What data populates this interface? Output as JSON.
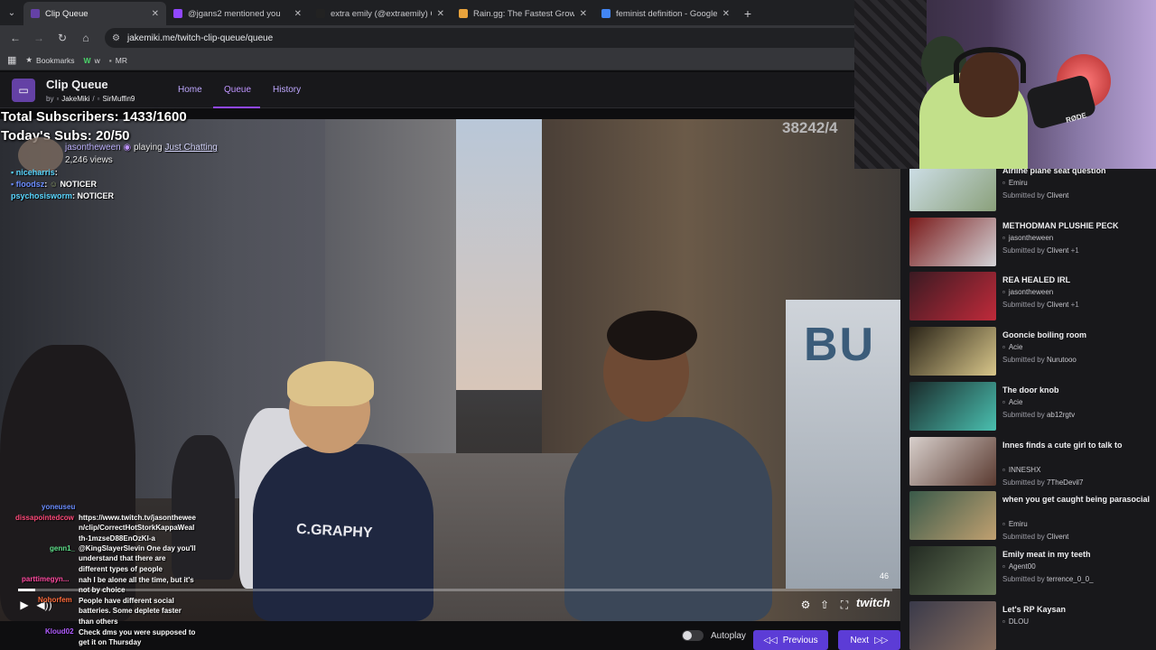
{
  "browser": {
    "tabs": [
      {
        "title": "Clip Queue",
        "active": true,
        "favicon_color": "#6441a5"
      },
      {
        "title": "@jgans2 mentioned you",
        "active": false,
        "favicon_color": "#9147ff"
      },
      {
        "title": "extra emily (@extraemily) Offici",
        "active": false,
        "favicon_color": "#222222"
      },
      {
        "title": "Rain.gg: The Fastest Growing C",
        "active": false,
        "favicon_color": "#e8a33c"
      },
      {
        "title": "feminist definition - Google Sea",
        "active": false,
        "favicon_color": "#4285f4"
      }
    ],
    "url": "jakemiki.me/twitch-clip-queue/queue",
    "bookmarks": [
      {
        "label": "Bookmarks"
      },
      {
        "label": "w"
      },
      {
        "label": "MR"
      }
    ]
  },
  "app": {
    "name": "Clip Queue",
    "by": "by",
    "author1": "JakeMiki",
    "separator": "/",
    "author2": "SirMuffin9",
    "nav": [
      "Home",
      "Queue",
      "History"
    ],
    "active_nav": "Queue"
  },
  "overlay": {
    "total_subs": "Total Subscribers: 1433/1600",
    "today_subs": "Today's Subs: 20/50",
    "clip_channel": "jasontheween",
    "clip_playing": "playing",
    "clip_category": "Just Chatting",
    "clip_views": "2,246 views",
    "counter": "38242/4"
  },
  "chat_top": [
    {
      "user": "niceharris",
      "text": "",
      "color": "#59d6ff"
    },
    {
      "user": "floodsz",
      "text": "NOTICER",
      "color": "#6a8cff"
    },
    {
      "user": "psychosisworm",
      "text": "NOTICER",
      "color": "#59d6ff"
    }
  ],
  "chat_bottom": [
    {
      "user": "yoneuseu",
      "text": "",
      "color": "#6a8cff"
    },
    {
      "user": "dissapointedcow",
      "text": "https://www.twitch.tv/jasontheween/clip/CorrectHotStorkKappaWealth-1mzseD88EnOzKl-a",
      "color": "#ff4a7a"
    },
    {
      "user": "genn1_",
      "text": "@KingSlayerSlevin One day you'll understand that there are different types of people",
      "color": "#5ee08a"
    },
    {
      "user": "parttimegyn...",
      "text": "nah I be alone all the time, but it's not by choice",
      "color": "#ff4aa0"
    },
    {
      "user": "Nohorfem",
      "text": "People have different social batteries. Some deplete faster than others",
      "color": "#ff6a3a"
    },
    {
      "user": "Kloud02",
      "text": "Check dms you were supposed to get it on Thursday",
      "color": "#b05cff"
    }
  ],
  "video": {
    "shirt_text": "C.GRAPHY",
    "window_text": "BU",
    "time_right": "46",
    "progress": 0.02,
    "brand": "twitch"
  },
  "controls": {
    "autoplay_label": "Autoplay",
    "autoplay_on": false,
    "previous_label": "Previous",
    "next_label": "Next"
  },
  "queue": {
    "submitted_by": "Submitted by",
    "items": [
      {
        "title": "Airline plane seat question",
        "channel": "Emiru",
        "submitter": "Clivent",
        "extra": "",
        "thumb": [
          "#cfe0ea",
          "#8aa07a"
        ]
      },
      {
        "title": "METHODMAN PLUSHIE PECK",
        "channel": "jasontheween",
        "submitter": "Clivent",
        "extra": "+1",
        "thumb": [
          "#7a1a1a",
          "#d4d4d8"
        ]
      },
      {
        "title": "REA HEALED IRL",
        "channel": "jasontheween",
        "submitter": "Clivent",
        "extra": "+1",
        "thumb": [
          "#3a1a22",
          "#c02a3a"
        ]
      },
      {
        "title": "Gooncie boiling room",
        "channel": "Acie",
        "submitter": "Nurutooo",
        "extra": "",
        "thumb": [
          "#2a2418",
          "#d8c68a"
        ]
      },
      {
        "title": "The door knob",
        "channel": "Acie",
        "submitter": "ab12rgtv",
        "extra": "",
        "thumb": [
          "#1a2a2a",
          "#4ac0b0"
        ]
      },
      {
        "title": "Innes finds a cute girl to talk to",
        "channel": "INNESHX",
        "submitter": "7TheDevil7",
        "extra": "",
        "thumb": [
          "#d8d0cc",
          "#5a3a30"
        ]
      },
      {
        "title": "when you get caught being parasocial",
        "channel": "Emiru",
        "submitter": "Clivent",
        "extra": "",
        "thumb": [
          "#3a5a4a",
          "#c0a070"
        ]
      },
      {
        "title": "Emily meat in my teeth",
        "channel": "Agent00",
        "submitter": "terrence_0_0_",
        "extra": "",
        "thumb": [
          "#222a22",
          "#6a7a5a"
        ]
      },
      {
        "title": "Let's RP Kaysan",
        "channel": "DLOU",
        "submitter": "",
        "extra": "",
        "thumb": [
          "#3a3a4a",
          "#8a7060"
        ]
      }
    ]
  }
}
